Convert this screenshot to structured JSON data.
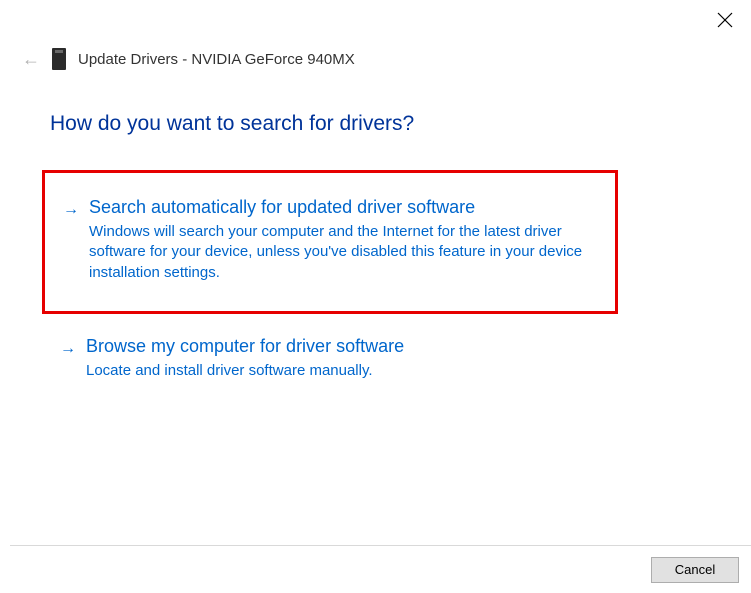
{
  "window": {
    "title": "Update Drivers - NVIDIA GeForce 940MX"
  },
  "heading": "How do you want to search for drivers?",
  "options": {
    "auto": {
      "title": "Search automatically for updated driver software",
      "desc": "Windows will search your computer and the Internet for the latest driver software for your device, unless you've disabled this feature in your device installation settings."
    },
    "browse": {
      "title": "Browse my computer for driver software",
      "desc": "Locate and install driver software manually."
    }
  },
  "buttons": {
    "cancel": "Cancel"
  }
}
